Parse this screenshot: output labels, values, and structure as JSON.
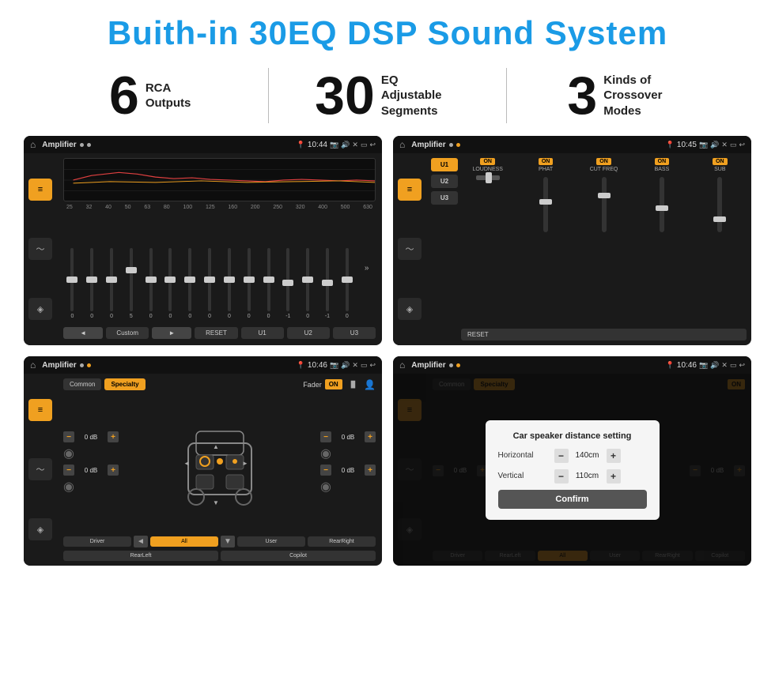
{
  "header": {
    "title": "Buith-in 30EQ DSP Sound System"
  },
  "stats": [
    {
      "number": "6",
      "label": "RCA\nOutputs"
    },
    {
      "number": "30",
      "label": "EQ Adjustable\nSegments"
    },
    {
      "number": "3",
      "label": "Kinds of\nCrossover Modes"
    }
  ],
  "screens": {
    "eq": {
      "title": "Amplifier",
      "time": "10:44",
      "frequencies": [
        "25",
        "32",
        "40",
        "50",
        "63",
        "80",
        "100",
        "125",
        "160",
        "200",
        "250",
        "320",
        "400",
        "500",
        "630"
      ],
      "values": [
        "0",
        "0",
        "0",
        "5",
        "0",
        "0",
        "0",
        "0",
        "0",
        "0",
        "0",
        "-1",
        "0",
        "-1"
      ],
      "bottom_buttons": [
        "◄",
        "Custom",
        "►",
        "RESET",
        "U1",
        "U2",
        "U3"
      ]
    },
    "crossover": {
      "title": "Amplifier",
      "time": "10:45",
      "presets": [
        "U1",
        "U2",
        "U3"
      ],
      "channels": [
        "LOUDNESS",
        "PHAT",
        "CUT FREQ",
        "BASS",
        "SUB"
      ],
      "reset_label": "RESET"
    },
    "fader": {
      "title": "Amplifier",
      "time": "10:46",
      "tabs": [
        "Common",
        "Specialty"
      ],
      "fader_label": "Fader",
      "on_label": "ON",
      "db_values": [
        "0 dB",
        "0 dB",
        "0 dB",
        "0 dB"
      ],
      "buttons": [
        "Driver",
        "RearLeft",
        "All",
        "User",
        "RearRight",
        "Copilot"
      ]
    },
    "dialog": {
      "title": "Amplifier",
      "time": "10:46",
      "tabs": [
        "Common",
        "Specialty"
      ],
      "on_label": "ON",
      "dialog_title": "Car speaker distance setting",
      "horizontal_label": "Horizontal",
      "horizontal_value": "140cm",
      "vertical_label": "Vertical",
      "vertical_value": "110cm",
      "confirm_label": "Confirm",
      "db_values": [
        "0 dB",
        "0 dB"
      ],
      "buttons": [
        "Driver",
        "RearLeft",
        "All",
        "User",
        "RearRight",
        "Copilot"
      ]
    }
  }
}
